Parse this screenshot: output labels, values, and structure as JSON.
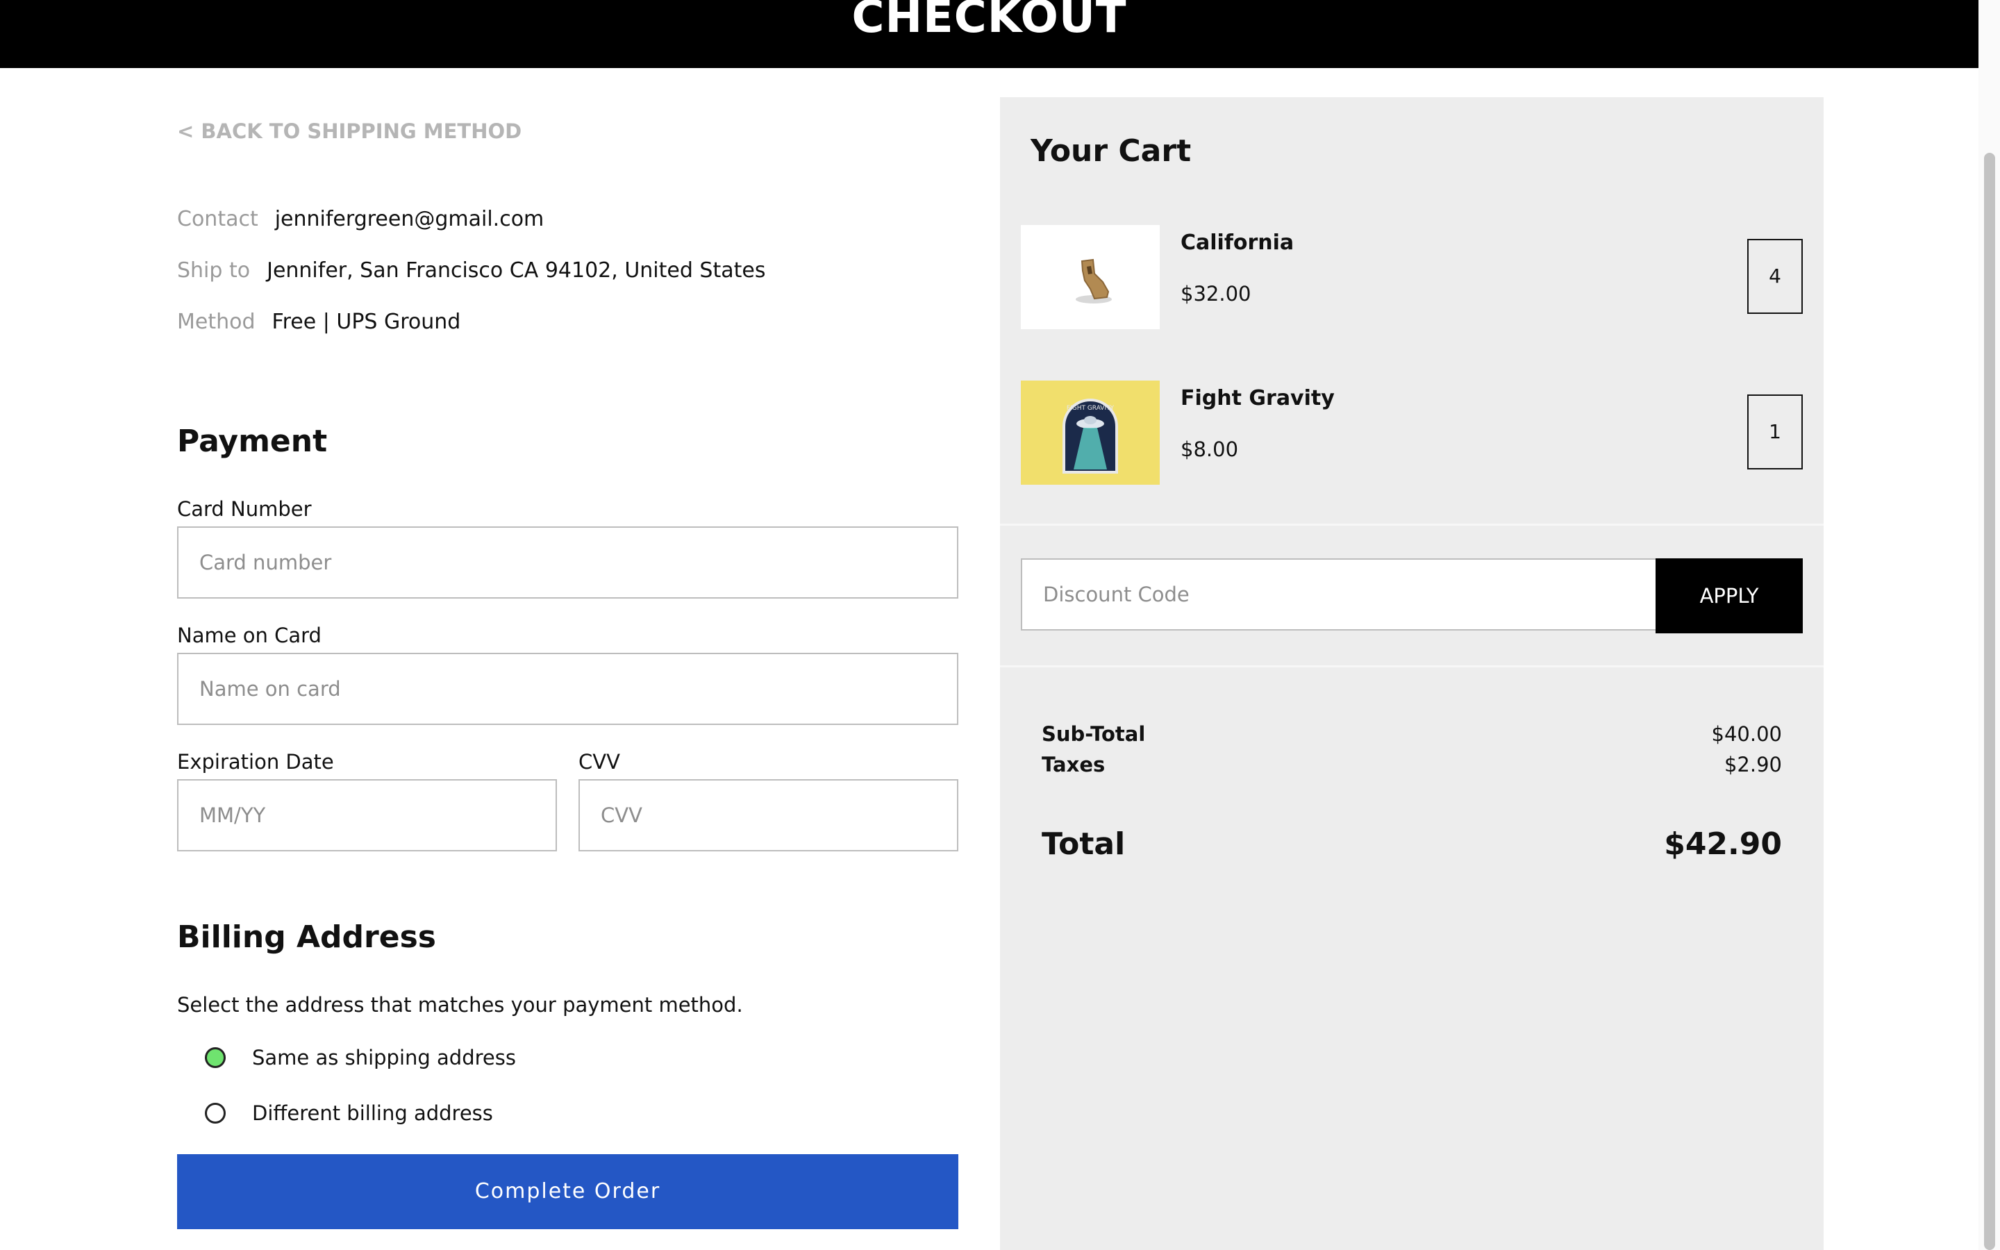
{
  "header": {
    "title": "CHECKOUT"
  },
  "back_link": "< BACK TO SHIPPING METHOD",
  "summary": {
    "contact": {
      "label": "Contact",
      "value": "jennifergreen@gmail.com"
    },
    "ship_to": {
      "label": "Ship to",
      "value": "Jennifer, San Francisco CA 94102, United States"
    },
    "method": {
      "label": "Method",
      "value": "Free | UPS Ground"
    }
  },
  "payment": {
    "title": "Payment",
    "card_number": {
      "label": "Card Number",
      "placeholder": "Card number"
    },
    "name_on_card": {
      "label": "Name on Card",
      "placeholder": "Name on card"
    },
    "expiration": {
      "label": "Expiration Date",
      "placeholder": "MM/YY"
    },
    "cvv": {
      "label": "CVV",
      "placeholder": "CVV"
    }
  },
  "billing": {
    "title": "Billing Address",
    "instruction": "Select the address that matches your payment method.",
    "options": [
      {
        "label": "Same as shipping address",
        "selected": true
      },
      {
        "label": "Different billing address",
        "selected": false
      }
    ]
  },
  "complete_button": "Complete Order",
  "cart": {
    "title": "Your Cart",
    "items": [
      {
        "name": "California",
        "price": "$32.00",
        "quantity": "4",
        "image": "california-pin-image"
      },
      {
        "name": "Fight Gravity",
        "price": "$8.00",
        "quantity": "1",
        "image": "fight-gravity-pin-image"
      }
    ],
    "discount": {
      "placeholder": "Discount Code",
      "button": "APPLY"
    },
    "subtotal": {
      "label": "Sub-Total",
      "value": "$40.00"
    },
    "taxes": {
      "label": "Taxes",
      "value": "$2.90"
    },
    "total": {
      "label": "Total",
      "value": "$42.90"
    }
  },
  "colors": {
    "header_bg": "#000000",
    "primary_button": "#2457c5",
    "radio_selected": "#6fe36f",
    "cart_bg": "#ededed"
  }
}
